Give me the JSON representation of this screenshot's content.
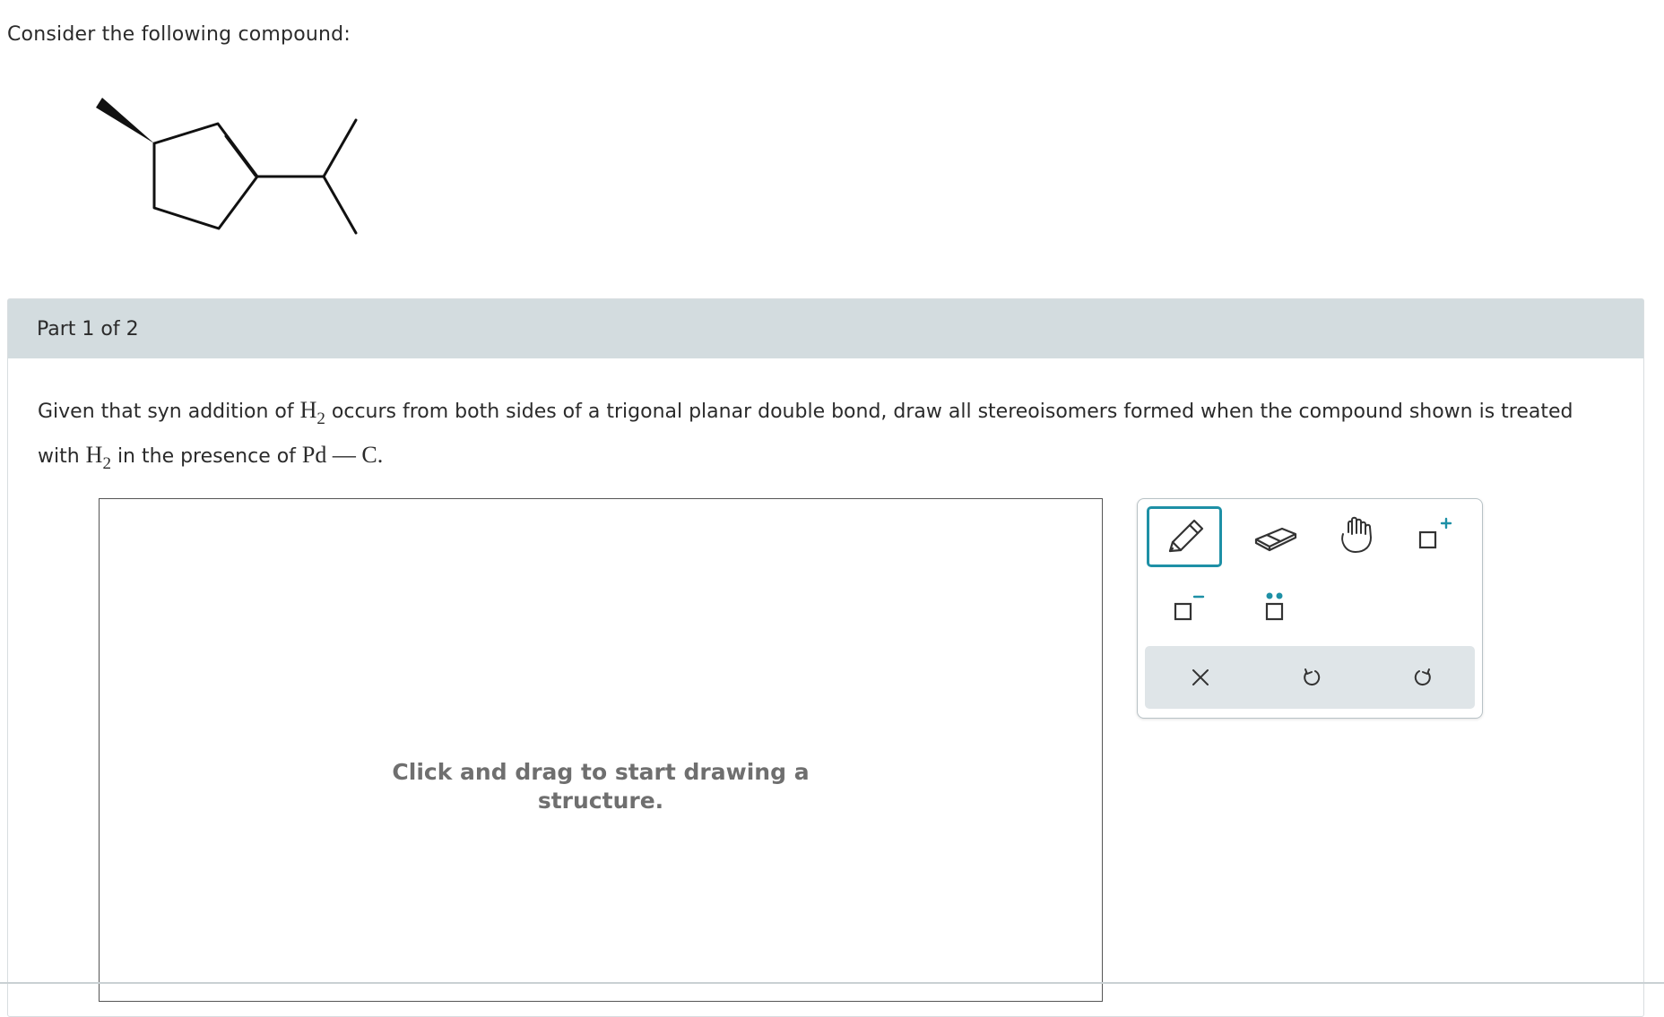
{
  "intro_text": "Consider the following compound:",
  "part": {
    "label": "Part 1 of 2"
  },
  "question": {
    "text_1": "Given that syn addition of ",
    "h": "H",
    "sub_2": "2",
    "text_2": " occurs from both sides of a trigonal planar double bond, draw all stereoisomers formed when the compound shown is treated",
    "text_3": "with ",
    "text_4": " in the presence of ",
    "pd_c": "Pd — C.",
    "catalyst_part1": "Pd",
    "catalyst_dash": "—",
    "catalyst_part2": "C."
  },
  "canvas": {
    "hint_line1": "Click and drag to start drawing a",
    "hint_line2": "structure."
  },
  "toolbar": {
    "tools": [
      "pencil-icon",
      "eraser-icon",
      "hand-icon",
      "add-charge-icon",
      "remove-charge-icon",
      "lone-pair-icon"
    ],
    "actions": [
      "close-icon",
      "undo-icon",
      "redo-icon"
    ],
    "active_tool": "pencil-icon",
    "accent_color": "#1e90a6"
  }
}
